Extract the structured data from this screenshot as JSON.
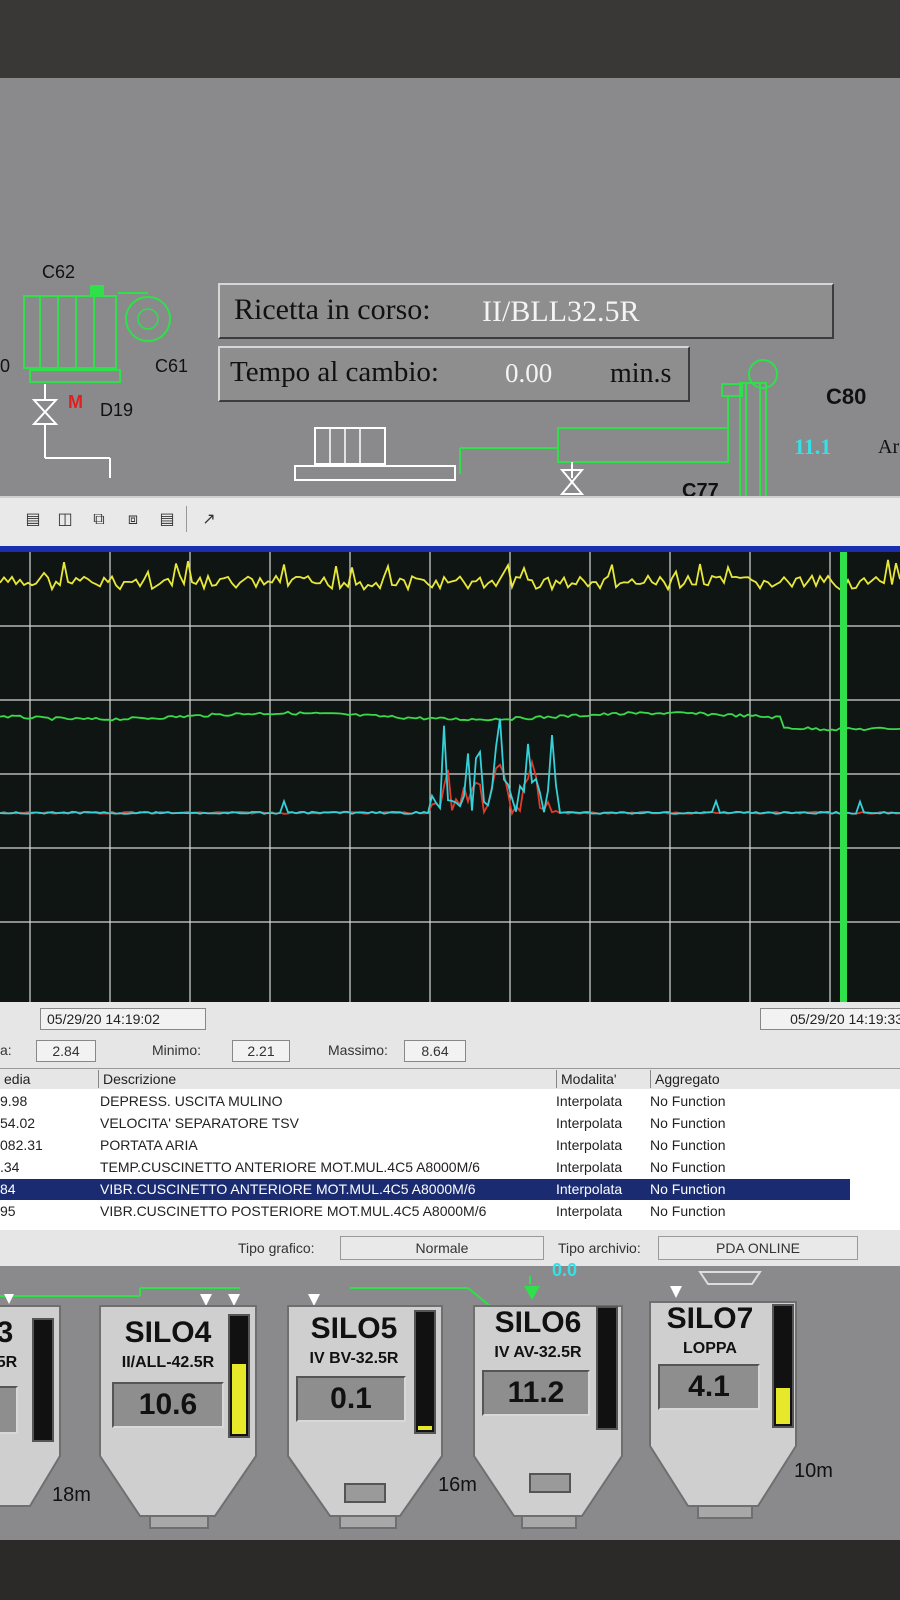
{
  "scada": {
    "labels": {
      "c62": "C62",
      "c61": "C61",
      "d19": "D19",
      "m": "M",
      "c80": "C80",
      "c77": "C77",
      "left_fragment": "0",
      "right_fragment": "Ar",
      "value_cyan": "11.1"
    },
    "recipe_label": "Ricetta in corso:",
    "recipe_value": "II/BLL32.5R",
    "change_label": "Tempo al cambio:",
    "change_value": "0.00",
    "change_unit": "min.s"
  },
  "toolbar": {
    "icons": [
      "grid-icon",
      "table-icon",
      "stack-icon",
      "export-icon",
      "copy-icon",
      "pen-icon"
    ]
  },
  "chart_data": {
    "type": "line",
    "grid": true,
    "series": [
      {
        "color": "#e8e83a",
        "level": 0.08,
        "noise": "high"
      },
      {
        "color": "#3ad94a",
        "level": 0.37,
        "noise": "low"
      },
      {
        "color": "#e03a2a",
        "level": 0.58,
        "noise": "burst"
      },
      {
        "color": "#35d0d8",
        "level": 0.58,
        "noise": "burst"
      }
    ],
    "cursor_color": "#2fe04a"
  },
  "timestamps": {
    "start": "05/29/20 14:19:02",
    "end": "05/29/20 14:19:33"
  },
  "stats": {
    "media_label": "a:",
    "media_value": "2.84",
    "min_label": "Minimo:",
    "min_value": "2.21",
    "max_label": "Massimo:",
    "max_value": "8.64"
  },
  "table": {
    "headers": [
      "edia",
      "Descrizione",
      "Modalita'",
      "Aggregato"
    ],
    "rows": [
      {
        "media": "9.98",
        "desc": "DEPRESS. USCITA MULINO",
        "mode": "Interpolata",
        "agg": "No Function",
        "selected": false
      },
      {
        "media": "54.02",
        "desc": "VELOCITA' SEPARATORE TSV",
        "mode": "Interpolata",
        "agg": "No Function",
        "selected": false
      },
      {
        "media": "082.31",
        "desc": "PORTATA ARIA",
        "mode": "Interpolata",
        "agg": "No Function",
        "selected": false
      },
      {
        "media": ".34",
        "desc": "TEMP.CUSCINETTO ANTERIORE MOT.MUL.4C5 A8000M/6",
        "mode": "Interpolata",
        "agg": "No Function",
        "selected": false
      },
      {
        "media": "84",
        "desc": "VIBR.CUSCINETTO ANTERIORE MOT.MUL.4C5 A8000M/6",
        "mode": "Interpolata",
        "agg": "No Function",
        "selected": true
      },
      {
        "media": "95",
        "desc": "VIBR.CUSCINETTO POSTERIORE MOT.MUL.4C5 A8000M/6",
        "mode": "Interpolata",
        "agg": "No Function",
        "selected": false
      }
    ]
  },
  "tipo": {
    "grafico_label": "Tipo grafico:",
    "grafico_value": "Normale",
    "archivio_label": "Tipo archivio:",
    "archivio_value": "PDA ONLINE"
  },
  "silos": [
    {
      "name": "3",
      "sub": "5R",
      "value": "",
      "level": 0.0
    },
    {
      "name": "SILO4",
      "sub": "II/ALL-42.5R",
      "value": "10.6",
      "level": 0.58
    },
    {
      "name": "SILO5",
      "sub": "IV BV-32.5R",
      "value": "0.1",
      "level": 0.03
    },
    {
      "name": "SILO6",
      "sub": "IV AV-32.5R",
      "value": "11.2",
      "level": 0.0
    },
    {
      "name": "SILO7",
      "sub": "LOPPA",
      "value": "4.1",
      "level": 0.3
    }
  ],
  "distances": [
    "18m",
    "16m",
    "10m"
  ],
  "silo6_top": "0.0"
}
